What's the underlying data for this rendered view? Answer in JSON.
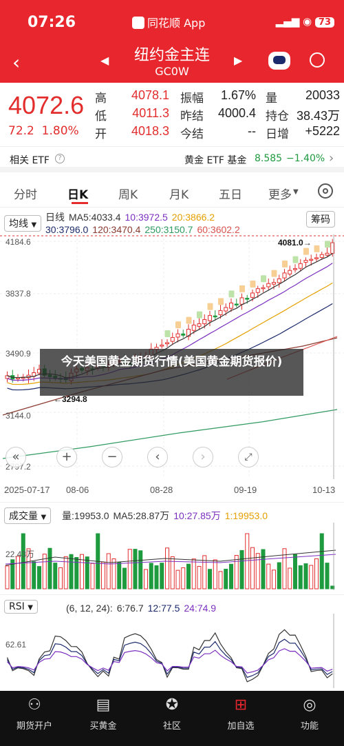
{
  "status": {
    "time": "07:26",
    "app": "同花顺 App",
    "battery": "73"
  },
  "header": {
    "title": "纽约金主连",
    "subtitle": "GC0W"
  },
  "quote": {
    "last": "4072.6",
    "change": "72.2",
    "change_pct": "1.80%",
    "rows": [
      [
        "高",
        "4078.1",
        "振幅",
        "1.67%",
        "量",
        "20033"
      ],
      [
        "低",
        "4011.3",
        "昨结",
        "4000.4",
        "持仓",
        "38.43万"
      ],
      [
        "开",
        "4018.3",
        "今结",
        "--",
        "日增",
        "+5222"
      ]
    ]
  },
  "etf": {
    "label": "相关 ETF",
    "name": "黄金 ETF 基金",
    "price": "8.585",
    "pct": "−1.40%"
  },
  "tabs": [
    "分时",
    "日K",
    "周K",
    "月K",
    "五日",
    "更多"
  ],
  "kline": {
    "ma_selector": "均线",
    "chip": "筹码",
    "legend_line1": [
      {
        "text": "日线",
        "color": "#333333"
      },
      {
        "text": "MA5:4033.4",
        "color": "#333333"
      },
      {
        "text": "10:3972.5",
        "color": "#7b2fbf"
      },
      {
        "text": "20:3866.2",
        "color": "#e5a000"
      }
    ],
    "legend_line2": [
      {
        "text": "30:3796.0",
        "color": "#1b2a6b"
      },
      {
        "text": "120:3470.4",
        "color": "#8b3a2f"
      },
      {
        "text": "250:3150.7",
        "color": "#2e9a5f"
      },
      {
        "text": "60:3602.2",
        "color": "#d9534f"
      }
    ],
    "y_ticks": [
      "4184.6",
      "3837.8",
      "3490.9",
      "3144.0",
      "2797.2"
    ],
    "x_ticks": [
      "2025-07-17",
      "08-06",
      "08-28",
      "09-19",
      "10-13"
    ],
    "max_marker": "4081.0→",
    "min_marker": "←3294.8"
  },
  "volume": {
    "selector": "成交量",
    "legend": [
      {
        "text": "量:19953.0",
        "color": "#333333"
      },
      {
        "text": "MA5:28.87万",
        "color": "#333333"
      },
      {
        "text": "10:27.85万",
        "color": "#7b2fbf"
      },
      {
        "text": "1:19953.0",
        "color": "#e5a000"
      }
    ],
    "y_tick": "22.43万"
  },
  "rsi": {
    "selector": "RSI",
    "legend": [
      {
        "text": "(6, 12, 24):",
        "color": "#333333"
      },
      {
        "text": "6:76.7",
        "color": "#333333"
      },
      {
        "text": "12:77.5",
        "color": "#1b2a6b"
      },
      {
        "text": "24:74.9",
        "color": "#7b2fbf"
      }
    ],
    "y_tick": "62.61"
  },
  "overlay_text": "今天美国黄金期货行情(美国黄金期货报价)",
  "bottom_nav": [
    "期货开户",
    "买黄金",
    "社区",
    "加自选",
    "功能"
  ]
}
